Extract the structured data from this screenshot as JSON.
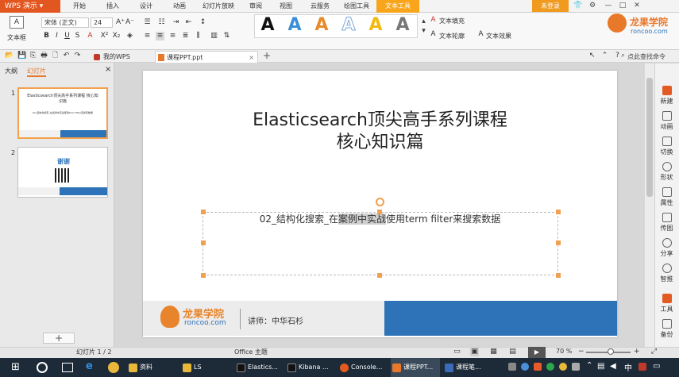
{
  "app": {
    "name": "WPS 演示",
    "login": "未登录",
    "menu": [
      "开始",
      "插入",
      "设计",
      "动画",
      "幻灯片放映",
      "审阅",
      "视图",
      "云服务",
      "绘图工具",
      "文本工具"
    ]
  },
  "ribbon": {
    "textbox_label": "文本框",
    "font_name": "宋体 (正文)",
    "font_size": "24",
    "fill_label": "文本填充",
    "outline_label": "文本轮廓",
    "effect_label": "文本效果",
    "art_letters": [
      "A",
      "A",
      "A",
      "A",
      "A",
      "A"
    ],
    "art_colors": [
      "#111111",
      "#3a8ed8",
      "#e88a2a",
      "#7aa8d8",
      "#f2b90f",
      "#777777"
    ]
  },
  "tabs": {
    "mywps": "我的WPS",
    "doc": "课程PPT.ppt",
    "add": "+",
    "find": "点此查找命令"
  },
  "leftpanel": {
    "tab_outline": "大纲",
    "tab_slides": "幻灯片",
    "close": "×",
    "add": "+",
    "thumbs": [
      {
        "num": "1",
        "title": "Elasticsearch顶尖高手系列课程 核心知识篇",
        "sub": "02_结构化搜索_在案例中实战使用term filter来搜索数据"
      },
      {
        "num": "2",
        "title": "谢谢"
      }
    ]
  },
  "slide": {
    "title_line1": "Elasticsearch顶尖高手系列课程",
    "title_line2": "核心知识篇",
    "subtitle_pre": "02_结构化搜索_在",
    "subtitle_highlight": "案例中实战",
    "subtitle_post": "使用term filter来搜索数据",
    "logo_cn": "龙果学院",
    "logo_url": "roncoo.com",
    "lecturer": "讲师：中华石杉",
    "accent": "#2e72b8",
    "orange": "#e8852c"
  },
  "rightpanel": [
    {
      "label": "新建",
      "color": "#e25b25"
    },
    {
      "label": "动画",
      "color": "#666666"
    },
    {
      "label": "切换",
      "color": "#666666"
    },
    {
      "label": "形状",
      "color": "#666666"
    },
    {
      "label": "属性",
      "color": "#666666"
    },
    {
      "label": "传图",
      "color": "#666666"
    },
    {
      "label": "分享",
      "color": "#666666"
    },
    {
      "label": "智推",
      "color": "#666666"
    },
    {
      "label": "工具",
      "color": "#666666"
    },
    {
      "label": "备份",
      "color": "#666666"
    }
  ],
  "status": {
    "slide_counter": "幻灯片 1 / 2",
    "theme": "Office 主题",
    "zoom": "70 %",
    "zoom_fraction": 0.55
  },
  "taskbar": {
    "items": [
      {
        "label": "资料",
        "color": "#e8b83a"
      },
      {
        "label": "LS",
        "color": "#e8b83a"
      },
      {
        "label": "Elastics...",
        "color": "#111111"
      },
      {
        "label": "Kibana ...",
        "color": "#111111"
      },
      {
        "label": "Console...",
        "color": "#e55b1f"
      },
      {
        "label": "课程PPT...",
        "color": "#e8782a"
      },
      {
        "label": "课程笔...",
        "color": "#3a6ab8"
      }
    ],
    "ime": "中"
  }
}
